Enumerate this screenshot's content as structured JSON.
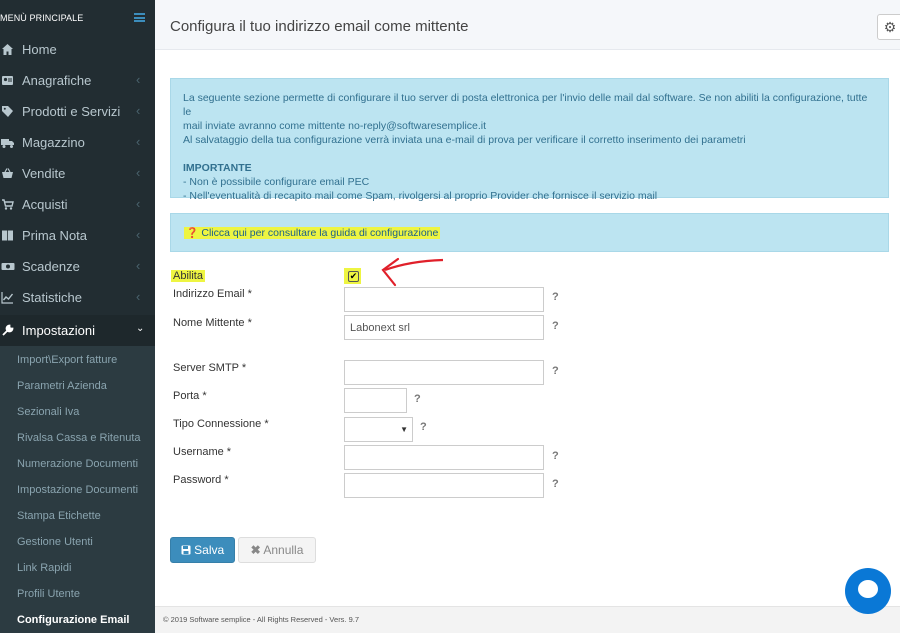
{
  "sidebar": {
    "title": "MENÙ PRINCIPALE",
    "items": [
      {
        "label": "Home",
        "icon": "dashboard-icon",
        "chevron": false
      },
      {
        "label": "Anagrafiche",
        "icon": "address-book-icon",
        "chevron": true
      },
      {
        "label": "Prodotti e Servizi",
        "icon": "tag-icon",
        "chevron": true
      },
      {
        "label": "Magazzino",
        "icon": "truck-icon",
        "chevron": true
      },
      {
        "label": "Vendite",
        "icon": "basket-icon",
        "chevron": true
      },
      {
        "label": "Acquisti",
        "icon": "cart-icon",
        "chevron": true
      },
      {
        "label": "Prima Nota",
        "icon": "book-icon",
        "chevron": true
      },
      {
        "label": "Scadenze",
        "icon": "money-icon",
        "chevron": true
      },
      {
        "label": "Statistiche",
        "icon": "chart-icon",
        "chevron": true
      },
      {
        "label": "Impostazioni",
        "icon": "wrench-icon",
        "chevron": true,
        "active": true
      }
    ],
    "submenu": [
      "Import\\Export fatture",
      "Parametri Azienda",
      "Sezionali Iva",
      "Rivalsa Cassa e Ritenuta",
      "Numerazione Documenti",
      "Impostazione Documenti",
      "Stampa Etichette",
      "Gestione Utenti",
      "Link Rapidi",
      "Profili Utente",
      "Configurazione Email"
    ],
    "active_submenu": "Configurazione Email"
  },
  "header": {
    "title": "Configura il tuo indirizzo email come mittente"
  },
  "info": {
    "line1": "La seguente sezione permette di configurare il tuo server di posta elettronica per l'invio delle mail dal software. Se non abiliti la configurazione, tutte le",
    "line2": "mail inviate avranno come mittente no-reply@softwaresemplice.it",
    "line3": "Al salvataggio della tua configurazione verrà inviata una e-mail di prova per verificare il corretto inserimento dei parametri",
    "important": "IMPORTANTE",
    "bullet1": "- Non è possibile configurare email PEC",
    "bullet2": "- Nell'eventualità di recapito mail come Spam, rivolgersi al proprio Provider che fornisce il servizio mail"
  },
  "guide": {
    "text": "Clicca qui per consultare la guida di configurazione"
  },
  "form": {
    "enable_label": "Abilita",
    "enabled": true,
    "email_label": "Indirizzo Email *",
    "email_value": "",
    "sender_label": "Nome Mittente *",
    "sender_value": "Labonext srl",
    "smtp_label": "Server SMTP *",
    "smtp_value": "",
    "port_label": "Porta *",
    "port_value": "",
    "conn_label": "Tipo Connessione *",
    "conn_value": "",
    "user_label": "Username *",
    "user_value": "",
    "pass_label": "Password *",
    "pass_value": "",
    "help": "?"
  },
  "buttons": {
    "save": "Salva",
    "cancel": "Annulla"
  },
  "footer": {
    "text": "© 2019 Software semplice - All Rights Reserved - Vers. 9.7"
  },
  "colors": {
    "sidebar_bg": "#222d32",
    "primary": "#3c8dbc",
    "info_bg": "#bce4f1",
    "highlight": "#eef542",
    "annotation_arrow": "#e0202a"
  }
}
